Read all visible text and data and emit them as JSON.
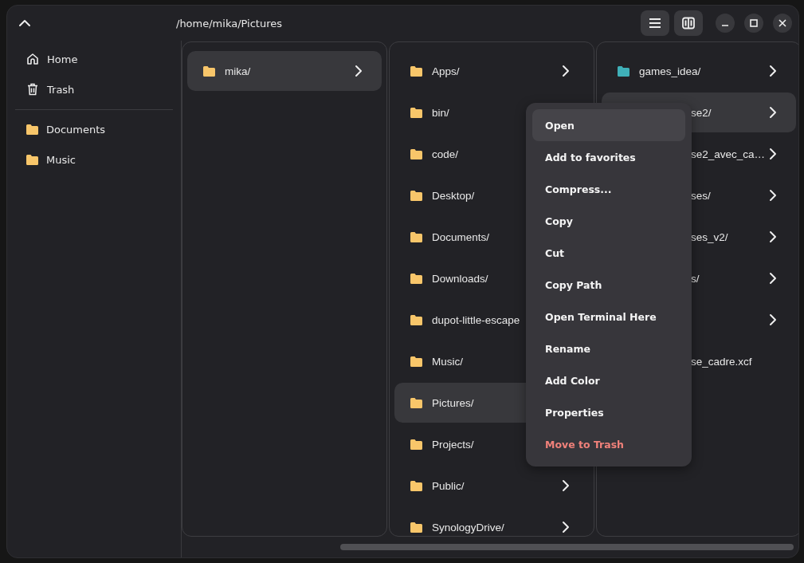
{
  "header": {
    "path": "/home/mika/Pictures",
    "view_buttons": [
      {
        "kind": "list"
      },
      {
        "kind": "columns"
      }
    ],
    "window_controls": [
      {
        "kind": "minimize"
      },
      {
        "kind": "maximize"
      },
      {
        "kind": "close"
      }
    ]
  },
  "sidebar": {
    "places": [
      {
        "label": "Home",
        "kind": "home"
      },
      {
        "label": "Trash",
        "kind": "trash"
      }
    ],
    "bookmarks": [
      {
        "label": "Documents",
        "kind": "folder"
      },
      {
        "label": "Music",
        "kind": "folder"
      }
    ]
  },
  "columns": [
    {
      "items": [
        {
          "kind": "folder",
          "name": "mika/",
          "selected": true,
          "chevron": true,
          "color": "#f8c66a"
        }
      ]
    },
    {
      "items": [
        {
          "kind": "folder",
          "name": "Apps/",
          "selected": false,
          "chevron": true,
          "color": "#f8c66a"
        },
        {
          "kind": "folder",
          "name": "bin/",
          "selected": false,
          "chevron": false,
          "color": "#f8c66a"
        },
        {
          "kind": "folder",
          "name": "code/",
          "selected": false,
          "chevron": false,
          "color": "#f8c66a"
        },
        {
          "kind": "folder",
          "name": "Desktop/",
          "selected": false,
          "chevron": false,
          "color": "#f8c66a"
        },
        {
          "kind": "folder",
          "name": "Documents/",
          "selected": false,
          "chevron": false,
          "color": "#f8c66a"
        },
        {
          "kind": "folder",
          "name": "Downloads/",
          "selected": false,
          "chevron": false,
          "color": "#f8c66a"
        },
        {
          "kind": "folder",
          "name": "dupot-little-escape",
          "selected": false,
          "chevron": false,
          "color": "#f8c66a"
        },
        {
          "kind": "folder",
          "name": "Music/",
          "selected": false,
          "chevron": false,
          "color": "#f8c66a"
        },
        {
          "kind": "folder",
          "name": "Pictures/",
          "selected": true,
          "chevron": false,
          "color": "#f8c66a"
        },
        {
          "kind": "folder",
          "name": "Projects/",
          "selected": false,
          "chevron": false,
          "color": "#f8c66a"
        },
        {
          "kind": "folder",
          "name": "Public/",
          "selected": false,
          "chevron": true,
          "color": "#f8c66a"
        },
        {
          "kind": "folder",
          "name": "SynologyDrive/",
          "selected": false,
          "chevron": true,
          "color": "#f8c66a"
        }
      ]
    },
    {
      "items": [
        {
          "kind": "folder",
          "name": "games_idea/",
          "selected": false,
          "chevron": true,
          "color": "#3fb0b8"
        },
        {
          "kind": "covered",
          "name": "se2/",
          "selected": true,
          "chevron": true
        },
        {
          "kind": "covered",
          "name": "se2_avec_ca…",
          "selected": false,
          "chevron": true
        },
        {
          "kind": "covered",
          "name": "ses/",
          "selected": false,
          "chevron": true
        },
        {
          "kind": "covered",
          "name": "ses_v2/",
          "selected": false,
          "chevron": true
        },
        {
          "kind": "covered",
          "name": "s/",
          "selected": false,
          "chevron": true
        },
        {
          "kind": "covered",
          "selected": false,
          "chevron": true
        },
        {
          "kind": "covered",
          "name": "se_cadre.xcf",
          "selected": false,
          "chevron": false
        }
      ]
    }
  ],
  "context_menu": {
    "items": [
      {
        "label": "Open",
        "kind": "normal",
        "selected": true
      },
      {
        "label": "Add to favorites",
        "kind": "normal",
        "selected": false
      },
      {
        "label": "Compress...",
        "kind": "normal",
        "selected": false
      },
      {
        "label": "Copy",
        "kind": "normal",
        "selected": false
      },
      {
        "label": "Cut",
        "kind": "normal",
        "selected": false
      },
      {
        "label": "Copy Path",
        "kind": "normal",
        "selected": false
      },
      {
        "label": "Open Terminal Here",
        "kind": "normal",
        "selected": false
      },
      {
        "label": "Rename",
        "kind": "normal",
        "selected": false
      },
      {
        "label": "Add Color",
        "kind": "normal",
        "selected": false
      },
      {
        "label": "Properties",
        "kind": "normal",
        "selected": false
      },
      {
        "label": "Move to Trash",
        "kind": "danger",
        "selected": false
      }
    ]
  }
}
